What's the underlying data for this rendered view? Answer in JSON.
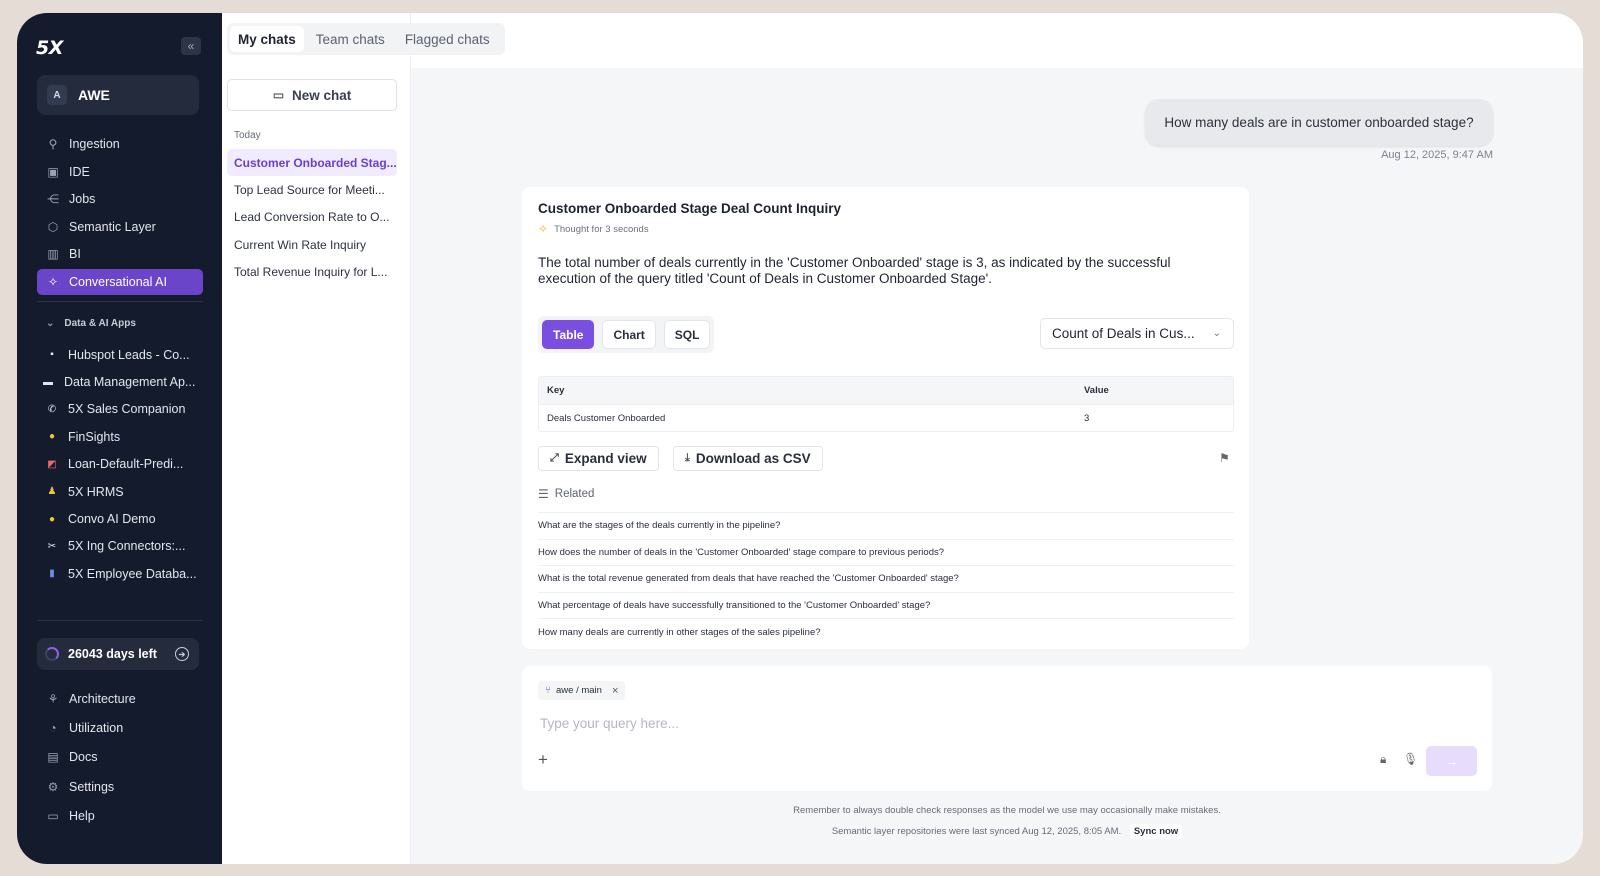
{
  "sidebar": {
    "logo": "5X",
    "collapse_icon": "double-chevron-left-icon",
    "workspace": {
      "avatar": "A",
      "name": "AWE"
    },
    "nav": [
      {
        "label": "Ingestion",
        "icon": "plug-icon"
      },
      {
        "label": "IDE",
        "icon": "terminal-icon"
      },
      {
        "label": "Jobs",
        "icon": "workflow-icon"
      },
      {
        "label": "Semantic Layer",
        "icon": "cube-icon"
      },
      {
        "label": "BI",
        "icon": "bar-chart-icon"
      },
      {
        "label": "Conversational AI",
        "icon": "sparkle-icon",
        "active": true
      }
    ],
    "apps_section": "Data & AI Apps",
    "apps": [
      {
        "label": "Hubspot Leads - Co...",
        "icon": "app-icon"
      },
      {
        "label": "Data Management Ap...",
        "icon": "laptop-icon"
      },
      {
        "label": "5X Sales Companion",
        "icon": "phone-icon"
      },
      {
        "label": "FinSights",
        "icon": "smile-icon"
      },
      {
        "label": "Loan-Default-Predi...",
        "icon": "chart-icon"
      },
      {
        "label": "5X HRMS",
        "icon": "person-icon"
      },
      {
        "label": "Convo AI Demo",
        "icon": "sunglasses-icon"
      },
      {
        "label": "5X Ing Connectors:...",
        "icon": "tools-icon"
      },
      {
        "label": "5X Employee Databa...",
        "icon": "people-icon"
      }
    ],
    "trial": "26043 days left",
    "bottom_nav": [
      {
        "label": "Architecture",
        "icon": "architecture-icon"
      },
      {
        "label": "Utilization",
        "icon": "gauge-icon"
      },
      {
        "label": "Docs",
        "icon": "docs-icon"
      },
      {
        "label": "Settings",
        "icon": "gear-icon"
      },
      {
        "label": "Help",
        "icon": "help-icon"
      }
    ]
  },
  "chat_tabs": [
    "My chats",
    "Team chats",
    "Flagged chats"
  ],
  "new_chat_label": "New chat",
  "today_label": "Today",
  "chats": [
    "Customer Onboarded Stag...",
    "Top Lead Source for Meeti...",
    "Lead Conversion Rate to O...",
    "Current Win Rate Inquiry",
    "Total Revenue Inquiry for L..."
  ],
  "conversation": {
    "user_message": "How many deals are in customer onboarded stage?",
    "timestamp": "Aug 12, 2025, 9:47 AM",
    "answer": {
      "title": "Customer Onboarded Stage Deal Count Inquiry",
      "thought": "Thought for 3 seconds",
      "text": "The total number of deals currently in the 'Customer Onboarded' stage is 3, as indicated by the successful execution of the query titled 'Count of Deals in Customer Onboarded Stage'.",
      "view_tabs": [
        "Table",
        "Chart",
        "SQL"
      ],
      "query_select": "Count of Deals in Cus...",
      "table": {
        "headers": [
          "Key",
          "Value"
        ],
        "rows": [
          [
            "Deals Customer Onboarded",
            "3"
          ]
        ]
      },
      "expand_label": "Expand view",
      "download_label": "Download as CSV",
      "related_label": "Related",
      "related": [
        "What are the stages of the deals currently in the pipeline?",
        "How does the number of deals in the 'Customer Onboarded' stage compare to previous periods?",
        "What is the total revenue generated from deals that have reached the 'Customer Onboarded' stage?",
        "What percentage of deals have successfully transitioned to the 'Customer Onboarded' stage?",
        "How many deals are currently in other stages of the sales pipeline?"
      ]
    }
  },
  "composer": {
    "branch": "awe / main",
    "placeholder": "Type your query here..."
  },
  "footer": {
    "disclaimer": "Remember to always double check responses as the model we use may occasionally make mistakes.",
    "sync_text": "Semantic layer repositories were last synced Aug 12, 2025, 8:05 AM.",
    "sync_button": "Sync now"
  },
  "colors": {
    "accent": "#7a4fe0",
    "sidebar_bg": "#141b2d",
    "active_nav": "#6b45c9"
  }
}
